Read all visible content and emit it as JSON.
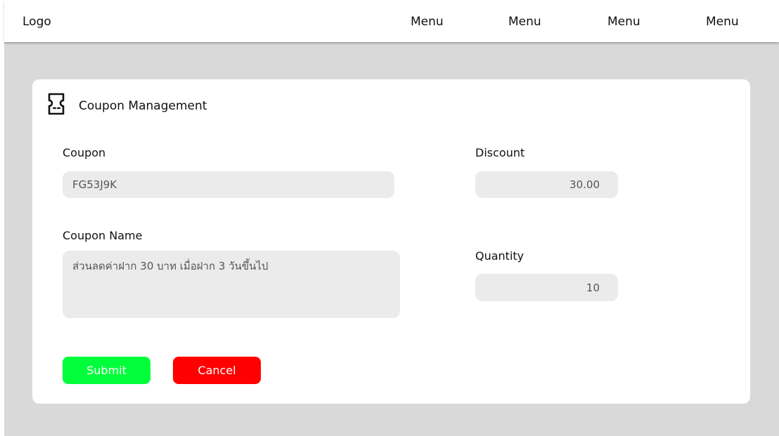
{
  "header": {
    "logo": "Logo",
    "menu": [
      "Menu",
      "Menu",
      "Menu",
      "Menu"
    ]
  },
  "card": {
    "icon": "ticket-icon",
    "title": "Coupon Management"
  },
  "form": {
    "coupon": {
      "label": "Coupon",
      "value": "FG53J9K"
    },
    "coupon_name": {
      "label": "Coupon Name",
      "value": "ส่วนลดค่าฝาก 30 บาท เมื่อฝาก 3 วันขึ้นไป"
    },
    "discount": {
      "label": "Discount",
      "value": "30.00"
    },
    "quantity": {
      "label": "Quantity",
      "value": "10"
    }
  },
  "actions": {
    "submit_label": "Submit",
    "cancel_label": "Cancel"
  },
  "colors": {
    "page_background": "#d9d9d9",
    "field_background": "#ebebeb",
    "submit": "#00ff3a",
    "cancel": "#ff0000"
  }
}
